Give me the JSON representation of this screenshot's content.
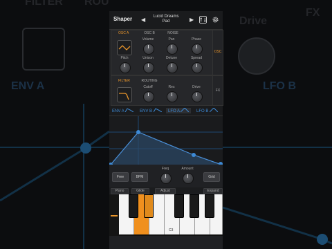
{
  "background": {
    "labels": {
      "filter": "FILTER",
      "routing": "ROU",
      "fx": "FX",
      "drive": "Drive",
      "env_a": "ENV A",
      "lfo_b": "LFO B"
    }
  },
  "header": {
    "title": "Shaper",
    "prev_arrow": "◀",
    "next_arrow": "▶",
    "preset_line1": "Lucid Dreams",
    "preset_line2": "Pad",
    "icons": [
      "routing-icon",
      "gear-icon"
    ]
  },
  "osc_panel": {
    "tabs": [
      "OSC A",
      "OSC B",
      "NOISE"
    ],
    "side_tab": "OSC",
    "knobs_row1": [
      "Volume",
      "Pan",
      "Phase"
    ],
    "knobs_row2": [
      "Pitch",
      "Unison",
      "Detune",
      "Spread"
    ]
  },
  "filter_panel": {
    "tabs": [
      "FILTER",
      "ROUTING"
    ],
    "side_tab": "FX",
    "knobs": [
      "Cutoff",
      "Res",
      "Drive"
    ]
  },
  "mod_tabs": [
    "ENV A",
    "ENV B",
    "LFO A",
    "LFO B"
  ],
  "mod_active": "LFO A",
  "lfo_controls": {
    "free": "Free",
    "bpm": "BPM",
    "freq": "Freq",
    "amount": "Amount",
    "grid": "Grid"
  },
  "keyboard_bar": {
    "buttons": [
      "Piano",
      "Glide",
      "Adjust",
      "Expand"
    ]
  },
  "keyboard": {
    "octave_label": "C3"
  },
  "colors": {
    "accent_orange": "#e8952b",
    "accent_blue": "#3d8ad6"
  }
}
